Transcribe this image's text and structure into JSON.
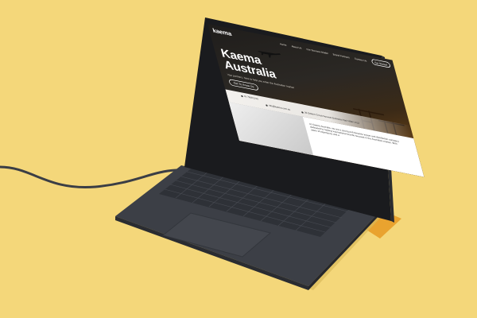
{
  "colors": {
    "background": "#f4d77a",
    "laptop_body": "#3a3d44",
    "keyboard": "#2d3036",
    "screen_dark": "#2b2824",
    "accent_orange": "#5a3a16"
  },
  "site": {
    "logo": "kaema",
    "nav": {
      "items": [
        "Home",
        "About Us",
        "Our Success Model",
        "Brand Partners",
        "Contact Us"
      ],
      "cta": "Get Started"
    },
    "hero": {
      "title_line1": "Kaema",
      "title_line2": "Australia",
      "subtitle": "Your partners, here to help you enter the Australian market",
      "button": "Get To Know Us"
    },
    "contact": {
      "phone": "02 7908 5220",
      "email": "info@kaema.com.au",
      "address": "36 Sobers Circuit Norwest Business Park NSW 2153"
    },
    "about_text": "At Kaema Australia, we are a young and dynamic import and distribution company dedicated to helping international brands succeed in the Australian market. With years of experience and a"
  },
  "icons": [
    "plane-icon",
    "crane-icon",
    "phone-icon",
    "email-icon",
    "location-icon"
  ]
}
